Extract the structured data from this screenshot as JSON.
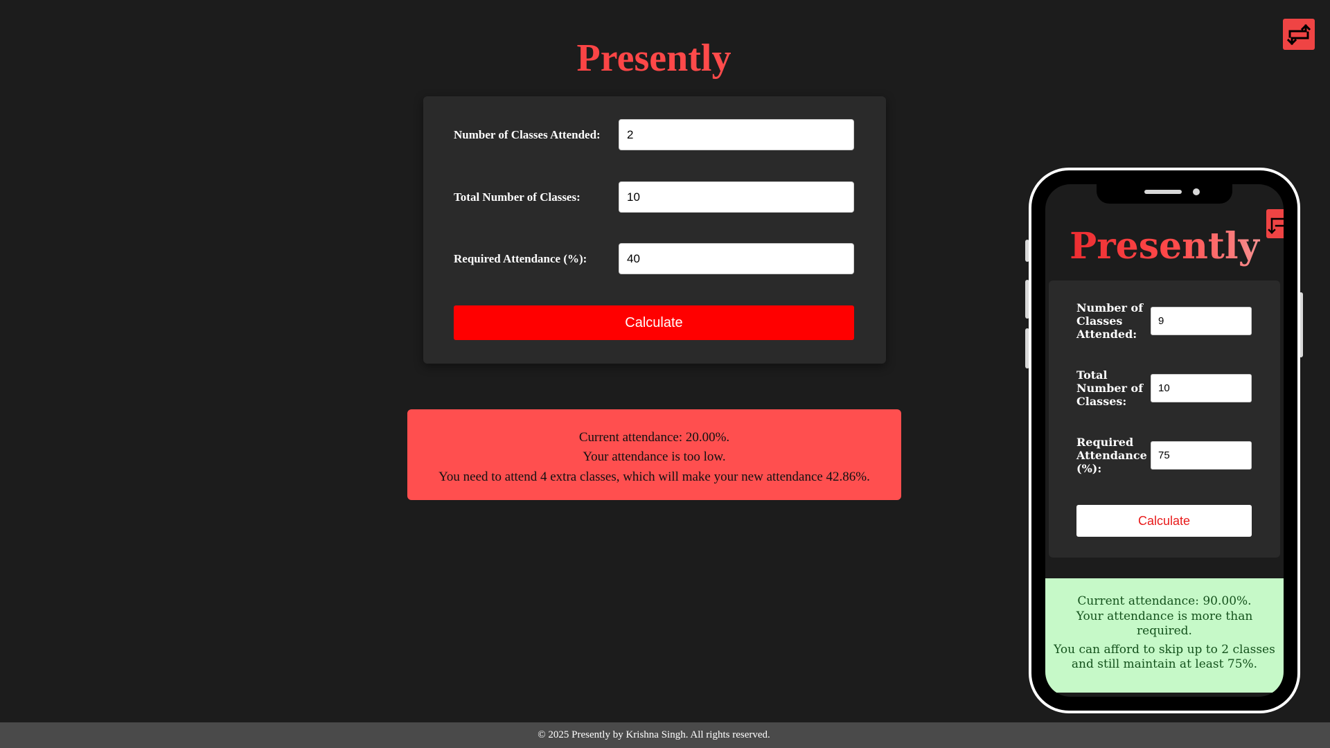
{
  "app": {
    "title": "Presently"
  },
  "main_form": {
    "fields": [
      {
        "label": "Number of Classes Attended:",
        "value": "2"
      },
      {
        "label": "Total Number of Classes:",
        "value": "10"
      },
      {
        "label": "Required Attendance (%):",
        "value": "40"
      }
    ],
    "calculate_label": "Calculate"
  },
  "main_result": {
    "line1": "Current attendance: 20.00%.",
    "line2": "Your attendance is too low.",
    "line3": "You need to attend 4 extra classes, which will make your new attendance 42.86%."
  },
  "mobile": {
    "title": "Presently",
    "fields": [
      {
        "label": "Number of Classes Attended:",
        "value": "9"
      },
      {
        "label": "Total Number of Classes:",
        "value": "10"
      },
      {
        "label": "Required Attendance (%):",
        "value": "75"
      }
    ],
    "calculate_label": "Calculate",
    "result": {
      "line1": "Current attendance: 90.00%.",
      "line2": "Your attendance is more than required.",
      "line3": "You can afford to skip up to 2 classes and still maintain at least 75%."
    }
  },
  "footer": {
    "text": "© 2025 Presently by Krishna Singh. All rights reserved."
  },
  "colors": {
    "background": "#1c1c1c",
    "card": "#2a2a2a",
    "accent_red": "#ff0000",
    "error_bg": "#ff4f4f",
    "success_bg": "#c6f9c8",
    "swap_button": "#ef4444"
  },
  "icons": {
    "swap_button": "swap-arrows-icon",
    "mobile_swap_button": "swap-arrows-icon"
  }
}
